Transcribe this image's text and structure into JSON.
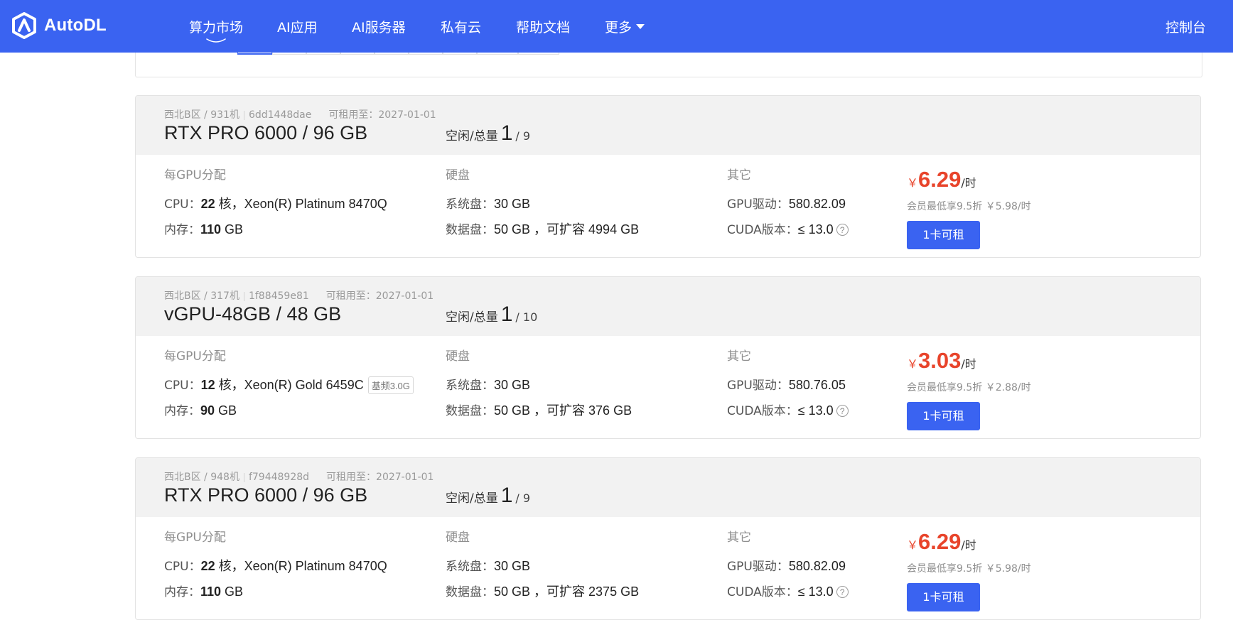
{
  "brand": {
    "name": "AutoDL",
    "accent": "#3a63f1",
    "price_color": "#e8442b"
  },
  "nav": {
    "items": [
      "算力市场",
      "AI应用",
      "AI服务器",
      "私有云",
      "帮助文档",
      "更多"
    ],
    "active_index": 0,
    "console": "控制台"
  },
  "labels": {
    "per_gpu": "每GPU分配",
    "disk": "硬盘",
    "other": "其它",
    "idle_total": "空闲/总量",
    "cpu": "CPU：",
    "mem": "内存：",
    "sys_disk": "系统盘：",
    "data_disk": "数据盘：",
    "gpu_driver": "GPU驱动：",
    "cuda": "CUDA版本：",
    "avail_until": "可租用至："
  },
  "machines": [
    {
      "region": "西北B区 / 931机",
      "id": "6dd1448dae",
      "avail_date": "2027-01-01",
      "gpu": "RTX PRO 6000 / 96 GB",
      "idle": "1",
      "total": "/ 9",
      "cpu_cores": "22",
      "cpu_rest": " 核，Xeon(R) Platinum 8470Q",
      "cpu_tag": "",
      "mem": "110",
      "mem_unit": " GB",
      "sys_disk": "30 GB",
      "data_disk": "50 GB ，可扩容 4994 GB",
      "driver": "580.82.09",
      "cuda": "≤ 13.0",
      "yen": "￥",
      "price": "6.29",
      "unit": "/时",
      "member": "会员最低享9.5折 ￥5.98/时",
      "button": "1卡可租"
    },
    {
      "region": "西北B区 / 317机",
      "id": "1f88459e81",
      "avail_date": "2027-01-01",
      "gpu": "vGPU-48GB / 48 GB",
      "idle": "1",
      "total": "/ 10",
      "cpu_cores": "12",
      "cpu_rest": " 核，Xeon(R) Gold 6459C",
      "cpu_tag": "基频3.0G",
      "mem": "90",
      "mem_unit": " GB",
      "sys_disk": "30 GB",
      "data_disk": "50 GB ，可扩容 376 GB",
      "driver": "580.76.05",
      "cuda": "≤ 13.0",
      "yen": "￥",
      "price": "3.03",
      "unit": "/时",
      "member": "会员最低享9.5折 ￥2.88/时",
      "button": "1卡可租"
    },
    {
      "region": "西北B区 / 948机",
      "id": "f79448928d",
      "avail_date": "2027-01-01",
      "gpu": "RTX PRO 6000 / 96 GB",
      "idle": "1",
      "total": "/ 9",
      "cpu_cores": "22",
      "cpu_rest": " 核，Xeon(R) Platinum 8470Q",
      "cpu_tag": "",
      "mem": "110",
      "mem_unit": " GB",
      "sys_disk": "30 GB",
      "data_disk": "50 GB ，可扩容 2375 GB",
      "driver": "580.82.09",
      "cuda": "≤ 13.0",
      "yen": "￥",
      "price": "6.29",
      "unit": "/时",
      "member": "会员最低享9.5折 ￥5.98/时",
      "button": "1卡可租"
    }
  ]
}
